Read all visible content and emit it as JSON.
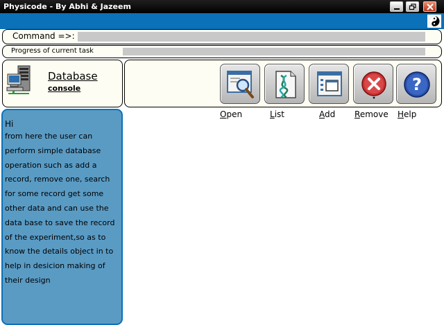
{
  "window": {
    "title": "Physicode - By Abhi & Jazeem",
    "minimize_icon": "minimize-icon",
    "restore_icon": "restore-icon",
    "close_icon": "close-icon"
  },
  "header": {
    "logo_icon": "yin-yang-logo-icon"
  },
  "command": {
    "label": "Command =>:",
    "value": ""
  },
  "progress": {
    "label": "Progress of current task",
    "percent": 0
  },
  "database": {
    "title": "Database",
    "subtitle": "console",
    "icon": "database-server-icon"
  },
  "toolbar": {
    "buttons": [
      {
        "label": "Open",
        "mnemonic": "O",
        "rest": "pen",
        "icon": "magnifier-window-icon"
      },
      {
        "label": "List",
        "mnemonic": "L",
        "rest": "ist",
        "icon": "dna-document-icon"
      },
      {
        "label": "Add",
        "mnemonic": "A",
        "rest": "dd",
        "icon": "add-window-icon"
      },
      {
        "label": "Remove",
        "mnemonic": "R",
        "rest": "emove",
        "icon": "red-x-icon"
      },
      {
        "label": "Help",
        "mnemonic": "H",
        "rest": "elp",
        "icon": "question-icon"
      }
    ]
  },
  "info": {
    "greeting": "Hi",
    "text": "from here the user can perform simple database operation such as add a record, remove one, search for some record get some other data and can use the data base to save the record of the experiment,so as to know the details object in to help in desicion making of their design"
  },
  "colors": {
    "accent": "#0b71b8",
    "panel": "#5a9bc4",
    "field": "#c8c8c8",
    "background": "#fdfdf4"
  }
}
